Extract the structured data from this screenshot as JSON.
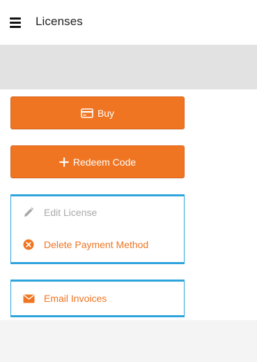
{
  "header": {
    "title": "Licenses",
    "menu_icon": "hamburger-menu-icon"
  },
  "actions": {
    "buy_label": "Buy",
    "buy_icon": "credit-card-icon",
    "redeem_label": "Redeem Code",
    "redeem_icon": "plus-icon"
  },
  "license_card": {
    "items": [
      {
        "label": "Edit License",
        "icon": "pencil-icon",
        "state": "disabled"
      },
      {
        "label": "Delete Payment Method",
        "icon": "close-circle-icon",
        "state": "enabled"
      }
    ]
  },
  "invoice_card": {
    "items": [
      {
        "label": "Email Invoices",
        "icon": "envelope-icon",
        "state": "enabled"
      }
    ]
  },
  "colors": {
    "accent": "#f07522",
    "card_border": "#2ea4dd",
    "disabled_text": "#a8a8a8"
  }
}
